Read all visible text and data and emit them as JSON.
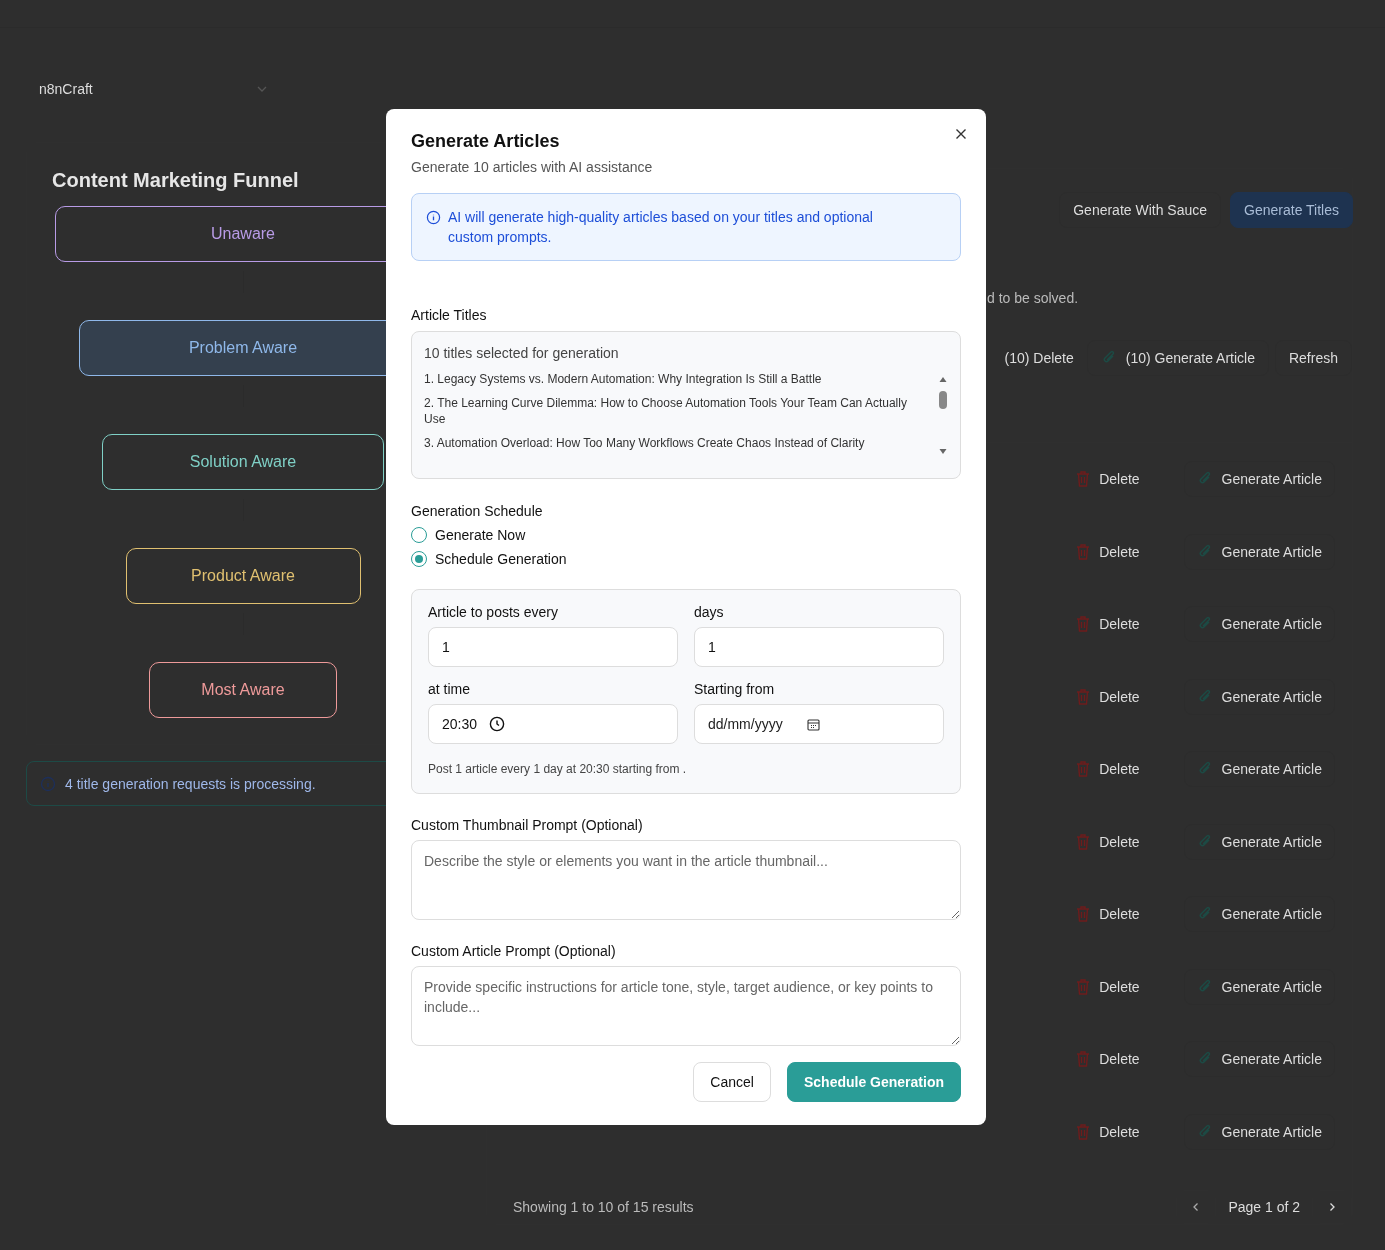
{
  "workspace_select": {
    "value": "n8nCraft"
  },
  "funnel": {
    "title": "Content Marketing Funnel",
    "stages": [
      {
        "label": "Unaware",
        "color": "#b89be6",
        "selected": false
      },
      {
        "label": "Problem Aware",
        "color": "#8fb8ea",
        "selected": true
      },
      {
        "label": "Solution Aware",
        "color": "#7fd0c6",
        "selected": false
      },
      {
        "label": "Product Aware",
        "color": "#e0c070",
        "selected": false
      },
      {
        "label": "Most Aware",
        "color": "#ee9a9a",
        "selected": false
      }
    ]
  },
  "processing_notice": "4 title generation requests is processing.",
  "toolbar": [
    {
      "label": "Generate With Sauce",
      "kind": "outline"
    },
    {
      "label": "Generate Titles",
      "kind": "primary"
    }
  ],
  "description_fragment": "d to be solved.",
  "bulk_actions": [
    {
      "label": "(10) Delete",
      "kind": "text"
    },
    {
      "label": "(10) Generate Article",
      "kind": "icon"
    },
    {
      "label": "Refresh",
      "kind": "outline"
    }
  ],
  "rows": [
    {
      "delete": "Delete",
      "generate": "Generate Article"
    },
    {
      "delete": "Delete",
      "generate": "Generate Article"
    },
    {
      "delete": "Delete",
      "generate": "Generate Article"
    },
    {
      "delete": "Delete",
      "generate": "Generate Article"
    },
    {
      "delete": "Delete",
      "generate": "Generate Article"
    },
    {
      "delete": "Delete",
      "generate": "Generate Article"
    },
    {
      "delete": "Delete",
      "generate": "Generate Article"
    },
    {
      "delete": "Delete",
      "generate": "Generate Article"
    },
    {
      "delete": "Delete",
      "generate": "Generate Article"
    },
    {
      "delete": "Delete",
      "generate": "Generate Article"
    }
  ],
  "pagination": {
    "summary": "Showing 1 to 10 of 15 results",
    "page": "Page 1 of 2"
  },
  "modal": {
    "title": "Generate Articles",
    "subtitle": "Generate 10 articles with AI assistance",
    "info": "AI will generate high-quality articles based on your titles and optional custom prompts.",
    "titles_label": "Article Titles",
    "titles_header": "10 titles selected for generation",
    "titles": [
      "1. Legacy Systems vs. Modern Automation: Why Integration Is Still a Battle",
      "2. The Learning Curve Dilemma: How to Choose Automation Tools Your Team Can Actually Use",
      "3. Automation Overload: How Too Many Workflows Create Chaos Instead of Clarity"
    ],
    "schedule_label": "Generation Schedule",
    "schedule_options": [
      {
        "label": "Generate Now",
        "selected": false
      },
      {
        "label": "Schedule Generation",
        "selected": true
      }
    ],
    "fields": [
      {
        "label": "Article to posts every",
        "value": "1",
        "kind": "text"
      },
      {
        "label": "days",
        "value": "1",
        "kind": "text"
      },
      {
        "label": "at time",
        "value": "20:30",
        "kind": "time"
      },
      {
        "label": "Starting from",
        "placeholder": "dd/mm/yyyy",
        "kind": "date"
      }
    ],
    "schedule_summary": "Post 1 article every 1 day at 20:30 starting from .",
    "prompts": [
      {
        "label": "Custom Thumbnail Prompt (Optional)",
        "placeholder": "Describe the style or elements you want in the article thumbnail..."
      },
      {
        "label": "Custom Article Prompt (Optional)",
        "placeholder": "Provide specific instructions for article tone, style, target audience, or key points to include..."
      }
    ],
    "buttons": [
      {
        "label": "Cancel",
        "kind": "secondary"
      },
      {
        "label": "Schedule Generation",
        "kind": "primary"
      }
    ]
  }
}
